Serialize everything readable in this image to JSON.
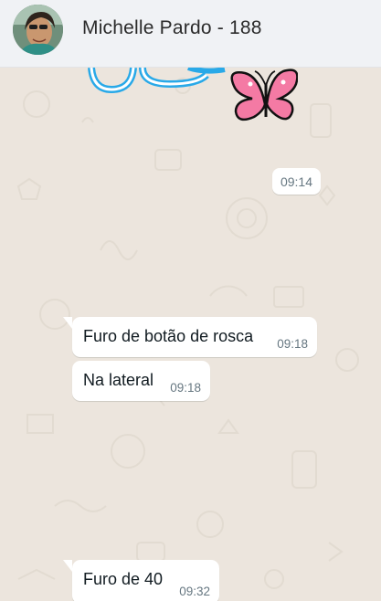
{
  "header": {
    "contact_name": "Michelle Pardo - 188"
  },
  "sticker_message": {
    "time": "09:14"
  },
  "messages": [
    {
      "text": "Furo de botão de rosca",
      "time": "09:18"
    },
    {
      "text": "Na lateral",
      "time": "09:18"
    },
    {
      "text": "Furo de 40",
      "time": "09:32"
    }
  ],
  "colors": {
    "header_bg": "#f0f2f5",
    "chat_bg": "#ece5dd",
    "bubble_bg": "#ffffff",
    "timestamp": "#667781"
  }
}
